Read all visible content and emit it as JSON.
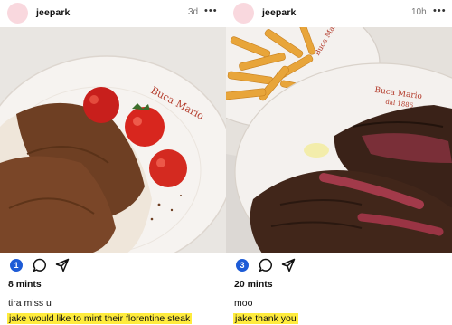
{
  "posts": [
    {
      "username": "jeepark",
      "timestamp": "3d",
      "more_icon": "ellipsis-icon",
      "photo": {
        "plate_text": "Buca Mario",
        "colors": {
          "plate": "#f6f3f0",
          "tablecloth": "#e9e6e2",
          "cocoa": "#6e3f23",
          "strawberry": "#d8261e",
          "cream": "#efe6da"
        }
      },
      "action_count": "1",
      "mints": "8 mints",
      "caption": "tira miss u",
      "reply": {
        "user": "jake",
        "text": "would like to mint their florentine steak"
      }
    },
    {
      "username": "jeepark",
      "timestamp": "10h",
      "more_icon": "ellipsis-icon",
      "photo": {
        "plate_text": "Buca Mario",
        "plate_subtext": "dal 1886",
        "colors": {
          "plate": "#f4f1ee",
          "fries": "#e8a53a",
          "steak_crust": "#3a2218",
          "steak_rare": "#a23a4a",
          "tablecloth": "#dcd8d4"
        }
      },
      "action_count": "3",
      "mints": "20 mints",
      "caption": "moo",
      "reply": {
        "user": "jake",
        "text": "thank you"
      }
    }
  ],
  "colors": {
    "badge": "#1d5bd6",
    "highlight": "#ffec3d",
    "avatar": "#f9d8de"
  }
}
